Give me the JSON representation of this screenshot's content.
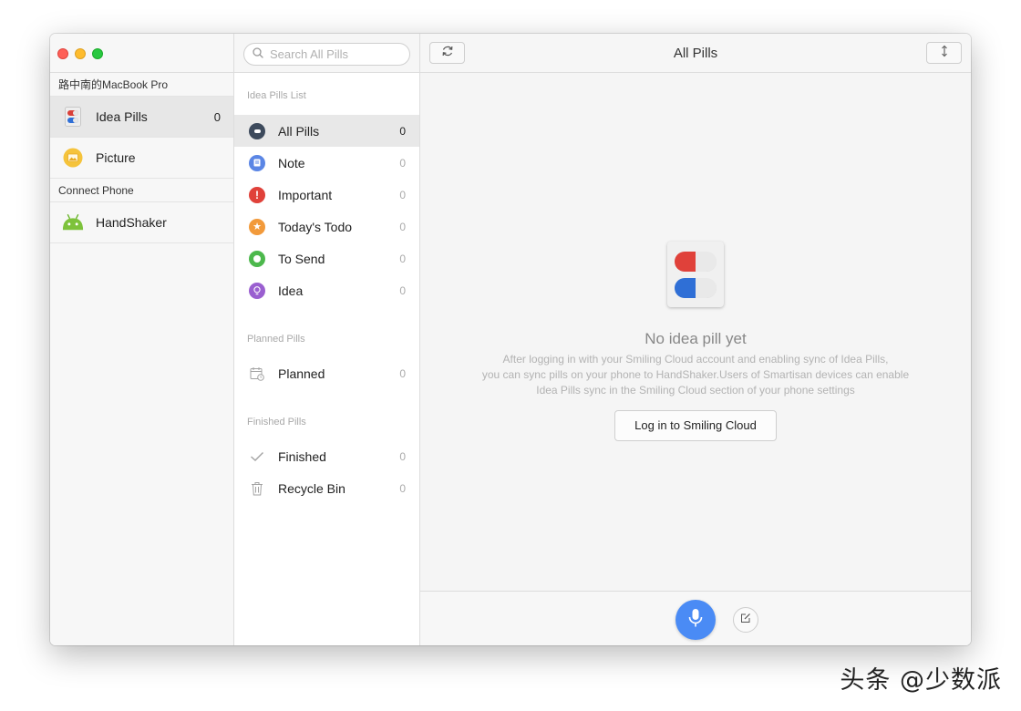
{
  "devices": {
    "computer_label": "路中南的MacBook Pro",
    "items": [
      {
        "label": "Idea Pills",
        "count": "0",
        "icon": "idea-pills-app-icon"
      },
      {
        "label": "Picture",
        "count": "",
        "icon": "picture-app-icon"
      }
    ],
    "phone_label": "Connect Phone",
    "phone_items": [
      {
        "label": "HandShaker",
        "icon": "android-icon"
      }
    ]
  },
  "search": {
    "placeholder": "Search All Pills",
    "value": ""
  },
  "pills_list": {
    "header": "Idea Pills List",
    "items": [
      {
        "label": "All Pills",
        "count": "0",
        "icon": "all-pills-icon",
        "color": "#3d4a5c"
      },
      {
        "label": "Note",
        "count": "0",
        "icon": "note-icon",
        "color": "#5b86e5"
      },
      {
        "label": "Important",
        "count": "0",
        "icon": "important-icon",
        "color": "#e0413a"
      },
      {
        "label": "Today's Todo",
        "count": "0",
        "icon": "star-icon",
        "color": "#f29a3b"
      },
      {
        "label": "To Send",
        "count": "0",
        "icon": "to-send-icon",
        "color": "#4cb84c"
      },
      {
        "label": "Idea",
        "count": "0",
        "icon": "lightbulb-icon",
        "color": "#9a5fd0"
      }
    ],
    "planned_header": "Planned Pills",
    "planned_items": [
      {
        "label": "Planned",
        "count": "0",
        "icon": "calendar-icon"
      }
    ],
    "finished_header": "Finished Pills",
    "finished_items": [
      {
        "label": "Finished",
        "count": "0",
        "icon": "checkmark-icon"
      },
      {
        "label": "Recycle Bin",
        "count": "0",
        "icon": "trash-icon"
      }
    ]
  },
  "main": {
    "title": "All Pills",
    "empty_title": "No idea pill yet",
    "empty_desc_lines": [
      "After logging in with your Smiling Cloud account and enabling sync of Idea Pills,",
      "you can sync pills on your phone to HandShaker.Users of Smartisan devices can enable",
      "Idea Pills sync in the Smiling Cloud section of your phone settings"
    ],
    "login_label": "Log in to Smiling Cloud"
  },
  "colors": {
    "accent": "#4a8bf5",
    "pill_red": "#e0413a",
    "pill_blue": "#2f6fd6"
  },
  "watermark": "头条 @少数派"
}
